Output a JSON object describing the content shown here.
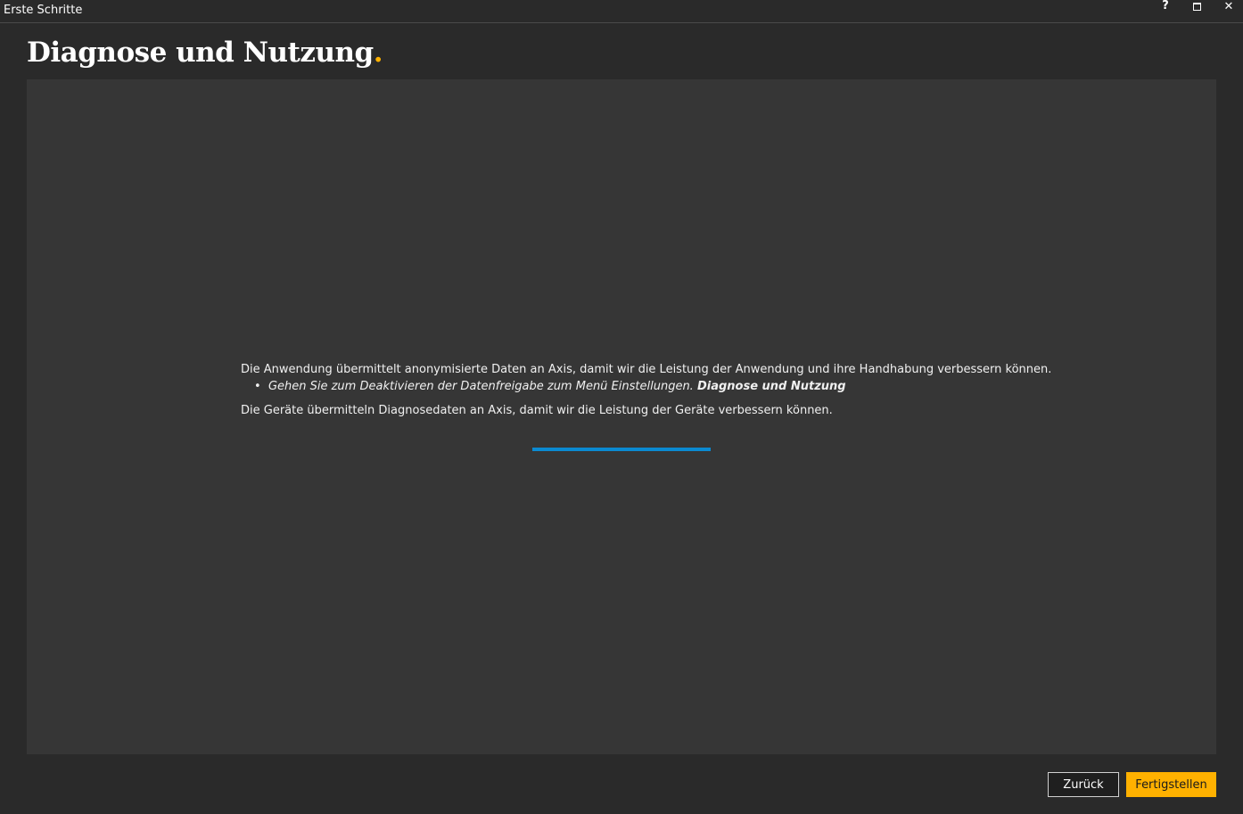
{
  "window": {
    "title": "Erste Schritte",
    "help_label": "?",
    "close_label": "✕"
  },
  "page": {
    "title": "Diagnose und Nutzung",
    "title_dot": "."
  },
  "content": {
    "line1": "Die Anwendung übermittelt anonymisierte Daten an Axis, damit wir die Leistung der Anwendung und ihre Handhabung verbessern können.",
    "bullet_symbol": "•",
    "bullet_text": "Gehen Sie zum Deaktivieren der Datenfreigabe zum Menü Einstellungen.",
    "bullet_bold": "Diagnose und Nutzung",
    "line3": "Die Geräte übermitteln Diagnosedaten an Axis, damit wir die Leistung der Geräte verbessern können."
  },
  "footer": {
    "back_label": "Zurück",
    "finish_label": "Fertigstellen"
  },
  "colors": {
    "accent": "#ffb100",
    "progress": "#0b8ad1",
    "background": "#2a2a2a",
    "panel": "#363636"
  }
}
